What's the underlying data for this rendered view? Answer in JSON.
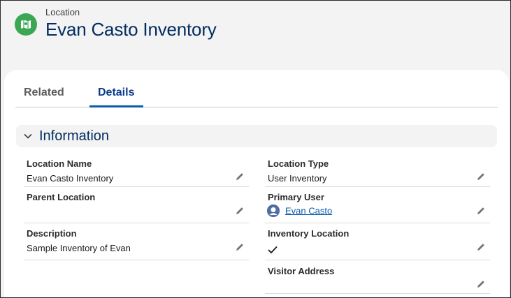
{
  "header": {
    "object_label": "Location",
    "record_title": "Evan Casto Inventory",
    "icon": "location-icon",
    "icon_color": "#3ba755"
  },
  "tabs": [
    {
      "label": "Related",
      "active": false
    },
    {
      "label": "Details",
      "active": true
    }
  ],
  "section": {
    "title": "Information",
    "expanded": true
  },
  "fields": {
    "location_name": {
      "label": "Location Name",
      "value": "Evan Casto Inventory"
    },
    "parent_location": {
      "label": "Parent Location",
      "value": ""
    },
    "description": {
      "label": "Description",
      "value": "Sample Inventory of Evan"
    },
    "location_type": {
      "label": "Location Type",
      "value": "User Inventory"
    },
    "primary_user": {
      "label": "Primary User",
      "value": "Evan Casto"
    },
    "inventory_location": {
      "label": "Inventory Location",
      "checked": true
    },
    "visitor_address": {
      "label": "Visitor Address",
      "value": ""
    }
  },
  "colors": {
    "title": "#032d60",
    "link": "#0b5cab",
    "active_tab_underline": "#0b5cab"
  }
}
